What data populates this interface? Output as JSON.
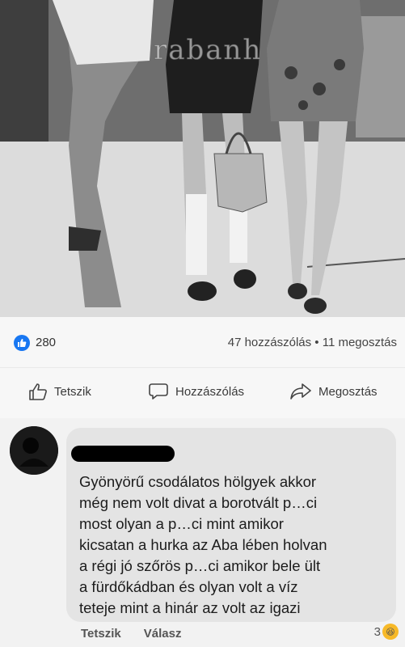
{
  "post": {
    "photo": {
      "watermark": "rabanh"
    },
    "stats": {
      "like_count": "280",
      "comments_shares": "47 hozzászólás • 11 megosztás"
    },
    "actions": {
      "like_label": "Tetszik",
      "comment_label": "Hozzászólás",
      "share_label": "Megosztás"
    }
  },
  "comment": {
    "text": "Gyönyörű csodálatos hölgyek akkor\nmég nem volt divat a borotvált p…ci\nmost olyan a p…ci mint amikor\nkicsatan a hurka az Aba lében holvan\na régi jó szőrös p…ci amikor bele ült\na fürdőkádban és olyan volt a víz\nteteje mint a hinár az volt az igazi",
    "like_label": "Tetszik",
    "reply_label": "Válasz",
    "reaction_count": "3"
  },
  "colors": {
    "like_blue": "#1877f2",
    "haha_yellow": "#f7b928"
  }
}
